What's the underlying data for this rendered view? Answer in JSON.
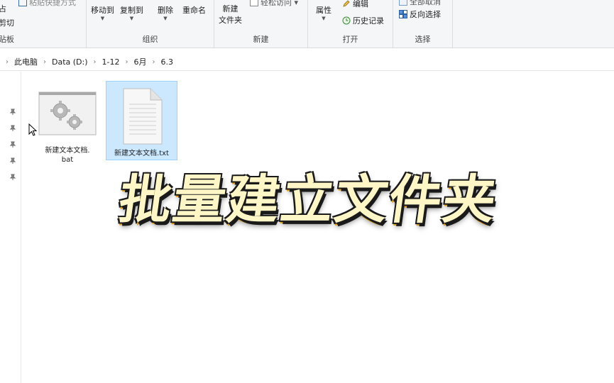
{
  "ribbon": {
    "clipboard": {
      "cut_label": "剪切",
      "top_partial": "占",
      "group_label": "贴板"
    },
    "organize": {
      "move_to": "移动到",
      "copy_to": "复制到",
      "delete": "删除",
      "rename": "重命名",
      "group_label": "组织"
    },
    "new": {
      "new_folder_line1": "新建",
      "new_folder_line2": "文件夹",
      "easy_access": "轻松访问",
      "group_label": "新建"
    },
    "open": {
      "properties": "属性",
      "edit": "编辑",
      "history": "历史记录",
      "group_label": "打开"
    },
    "select": {
      "select_all_partial": "全部取消",
      "invert": "反向选择",
      "group_label": "选择"
    }
  },
  "breadcrumb": [
    "此电脑",
    "Data (D:)",
    "1-12",
    "6月",
    "6.3"
  ],
  "files": [
    {
      "name_line1": "新建文本文档.",
      "name_line2": "bat",
      "icon": "batch-file-icon"
    },
    {
      "name_line1": "新建文本文档.txt",
      "icon": "text-file-icon",
      "selected": true
    }
  ],
  "overlay": {
    "title": "批量建立文件夹"
  },
  "colors": {
    "selection": "#cce8ff",
    "overlay_fill": "#fff3b0",
    "overlay_outline": "#1a1a1a"
  }
}
